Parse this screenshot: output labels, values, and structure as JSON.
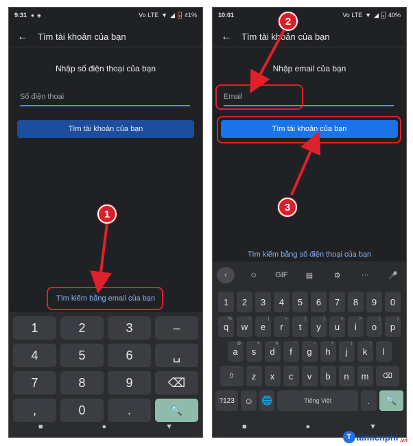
{
  "left": {
    "status": {
      "time": "9:31",
      "battery": "41%",
      "net": "Vo LTE"
    },
    "app_bar_title": "Tìm tài khoản của bạn",
    "subtitle": "Nhập số điện thoại của bạn",
    "input_placeholder": "Số điện thoại",
    "primary_button": "Tìm tài khoản của bạn",
    "alt_link": "Tìm kiếm bằng email của bạn",
    "numpad_keys": [
      "1",
      "2",
      "3",
      "–",
      "4",
      "5",
      "6",
      "␣",
      "7",
      "8",
      "9",
      "⌫",
      ",",
      "0",
      ".",
      "🔍"
    ]
  },
  "right": {
    "status": {
      "time": "10:01",
      "battery": "40%",
      "net": "Vo LTE"
    },
    "app_bar_title": "Tìm tài khoản của bạn",
    "subtitle": "Nhập email của bạn",
    "input_placeholder": "Email",
    "primary_button": "Tìm tài khoản của bạn",
    "alt_link": "Tìm kiếm bằng số điện thoại của bạn",
    "kb_toolbar": [
      "‹",
      "☺",
      "GIF",
      "▤",
      "⚙",
      "···",
      "🎤"
    ],
    "row_numbers": [
      "1",
      "2",
      "3",
      "4",
      "5",
      "6",
      "7",
      "8",
      "9",
      "0"
    ],
    "row_q": [
      "q",
      "w",
      "e",
      "r",
      "t",
      "y",
      "u",
      "i",
      "o",
      "p"
    ],
    "row_q_sup": [
      "%",
      "\\",
      "|",
      "=",
      "[",
      "]",
      "<",
      ">",
      "{",
      "}"
    ],
    "row_a": [
      "a",
      "s",
      "d",
      "f",
      "g",
      "h",
      "j",
      "k",
      "l"
    ],
    "row_a_sup": [
      "@",
      "#",
      "&",
      "*",
      "-",
      "+",
      "(",
      ")",
      ""
    ],
    "row_z": [
      "⇧",
      "z",
      "x",
      "c",
      "v",
      "b",
      "n",
      "m",
      "⌫"
    ],
    "row_bottom": {
      "sym": "?123",
      "emoji": "☺",
      "globe": "🌐",
      "space": "Tiếng Việt",
      "period": ".",
      "search": "🔍"
    }
  },
  "nav_icons": [
    "■",
    "●",
    "▼"
  ],
  "annotations": [
    "1",
    "2",
    "3"
  ],
  "watermark": {
    "logo": "T",
    "name": "aimienphi",
    "tld": ".vn"
  },
  "colors": {
    "highlight": "#e0202a",
    "badge": "#d9202a",
    "link": "#8ab4f8",
    "button_active": "#1a73e8"
  }
}
